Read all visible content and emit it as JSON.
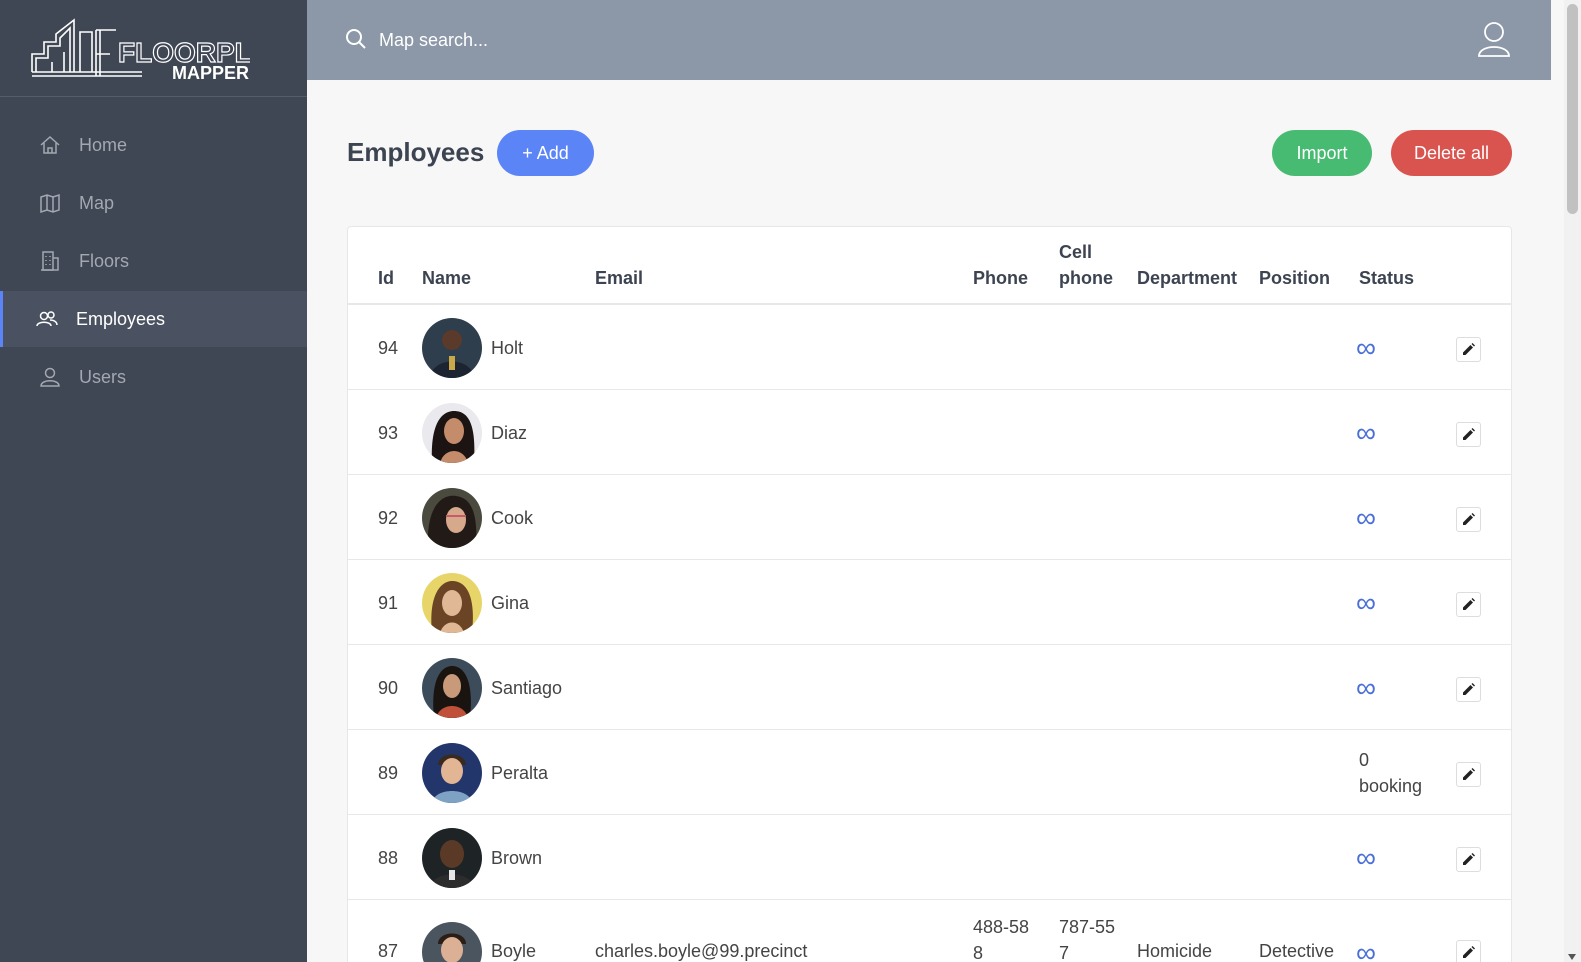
{
  "logo": {
    "line1": "FLOORPLAN",
    "line2": "MAPPER"
  },
  "sidebar": {
    "items": [
      {
        "label": "Home",
        "icon": "home-icon"
      },
      {
        "label": "Map",
        "icon": "map-icon"
      },
      {
        "label": "Floors",
        "icon": "building-icon"
      },
      {
        "label": "Employees",
        "icon": "people-icon",
        "active": true
      },
      {
        "label": "Users",
        "icon": "user-icon"
      }
    ]
  },
  "header": {
    "search_placeholder": "Map search..."
  },
  "page": {
    "title": "Employees",
    "add_label": "+ Add",
    "import_label": "Import",
    "delete_all_label": "Delete all"
  },
  "table": {
    "columns": {
      "id": "Id",
      "name": "Name",
      "email": "Email",
      "phone": "Phone",
      "cell_line1": "Cell",
      "cell_line2": "phone",
      "department": "Department",
      "position": "Position",
      "status": "Status"
    },
    "rows": [
      {
        "id": "94",
        "name": "Holt",
        "status": "∞"
      },
      {
        "id": "93",
        "name": "Diaz",
        "status": "∞"
      },
      {
        "id": "92",
        "name": "Cook",
        "status": "∞"
      },
      {
        "id": "91",
        "name": "Gina",
        "status": "∞"
      },
      {
        "id": "90",
        "name": "Santiago",
        "status": "∞"
      },
      {
        "id": "89",
        "name": "Peralta",
        "status_line1": "0",
        "status_line2": "booking"
      },
      {
        "id": "88",
        "name": "Brown",
        "status": "∞"
      },
      {
        "id": "87",
        "name": "Boyle",
        "email": "charles.boyle@99.precinct",
        "phone": "488-588",
        "cell": "787-557",
        "department": "Homicide",
        "position": "Detective",
        "status": "∞"
      }
    ]
  },
  "colors": {
    "sidebar": "#3f4654",
    "header": "#8c98a8",
    "accent": "#5b84f7",
    "import": "#48bb73",
    "delete": "#d9534f"
  }
}
